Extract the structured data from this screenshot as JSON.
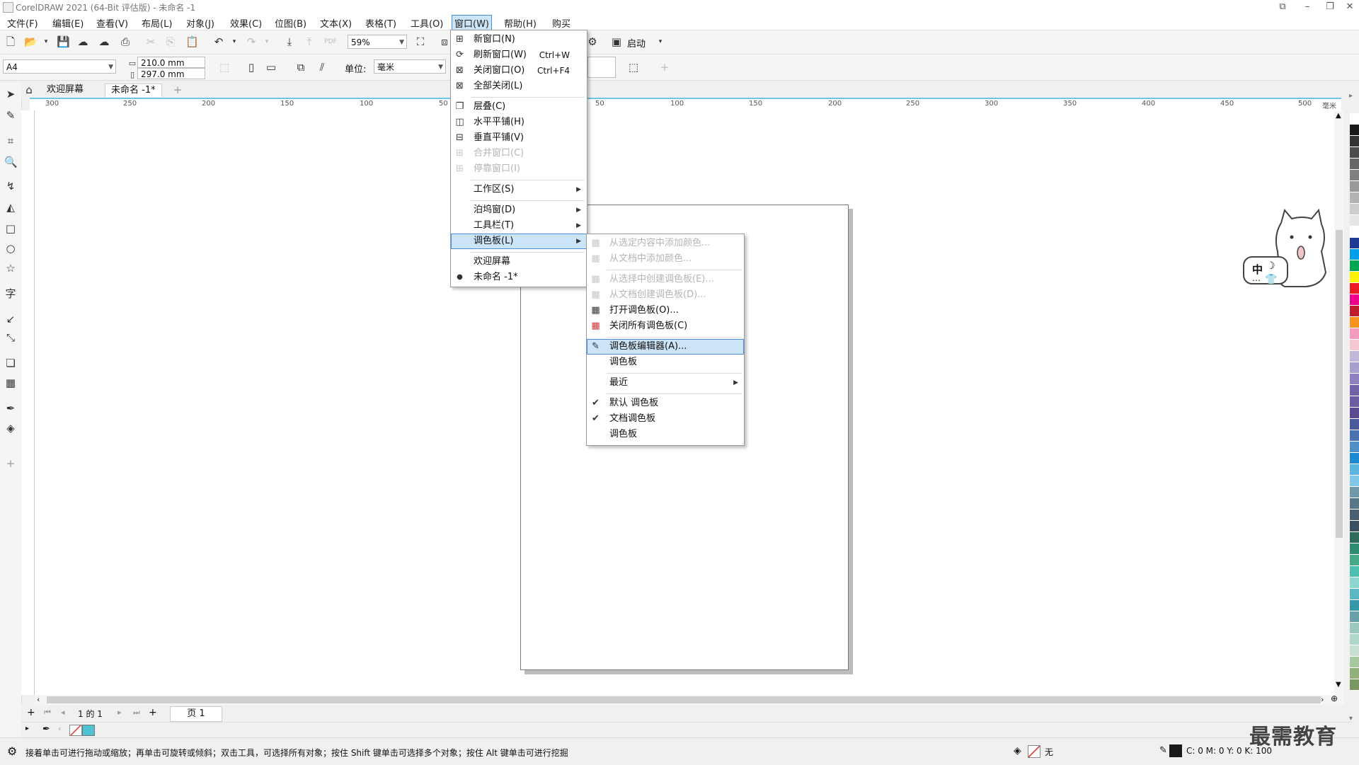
{
  "window": {
    "title": "CorelDRAW 2021 (64-Bit 评估版) - 未命名 -1"
  },
  "menubar": {
    "items": [
      "文件(F)",
      "编辑(E)",
      "查看(V)",
      "布局(L)",
      "对象(J)",
      "效果(C)",
      "位图(B)",
      "文本(X)",
      "表格(T)",
      "工具(O)",
      "窗口(W)",
      "帮助(H)",
      "购买"
    ]
  },
  "toolbar": {
    "zoom": "59%",
    "launch_label": "启动",
    "page_size": "A4",
    "width": "210.0 mm",
    "height": "297.0 mm",
    "units_label": "单位:",
    "units_value": "毫米"
  },
  "doc_tabs": {
    "welcome": "欢迎屏幕",
    "document": "未命名 -1*"
  },
  "ruler": {
    "h_ticks": [
      "300",
      "250",
      "200",
      "150",
      "100",
      "50",
      "50",
      "100",
      "150",
      "200",
      "250",
      "300",
      "350",
      "400",
      "450",
      "500"
    ],
    "h_unit": "毫米"
  },
  "window_menu": {
    "items": [
      {
        "label": "新窗口(N)",
        "shortcut": ""
      },
      {
        "label": "刷新窗口(W)",
        "shortcut": "Ctrl+W"
      },
      {
        "label": "关闭窗口(O)",
        "shortcut": "Ctrl+F4"
      },
      {
        "label": "全部关闭(L)",
        "shortcut": ""
      },
      {
        "label": "层叠(C)"
      },
      {
        "label": "水平平铺(H)"
      },
      {
        "label": "垂直平铺(V)"
      },
      {
        "label": "合并窗口(C)"
      },
      {
        "label": "停靠窗口(I)"
      },
      {
        "label": "工作区(S)"
      },
      {
        "label": "泊坞窗(D)"
      },
      {
        "label": "工具栏(T)"
      },
      {
        "label": "调色板(L)"
      },
      {
        "label": "欢迎屏幕"
      },
      {
        "label": "未命名 -1*"
      }
    ]
  },
  "palette_menu": {
    "items": [
      {
        "label": "从选定内容中添加颜色..."
      },
      {
        "label": "从文档中添加颜色..."
      },
      {
        "label": "从选择中创建调色板(E)..."
      },
      {
        "label": "从文档创建调色板(D)..."
      },
      {
        "label": "打开调色板(O)..."
      },
      {
        "label": "关闭所有调色板(C)"
      },
      {
        "label": "调色板编辑器(A)..."
      },
      {
        "label": "调色板"
      },
      {
        "label": "最近"
      },
      {
        "label": "默认 调色板"
      },
      {
        "label": "文档调色板"
      },
      {
        "label": "调色板"
      }
    ]
  },
  "pagenav": {
    "page_count": "1 的 1",
    "page_tab": "页 1"
  },
  "status": {
    "hint": "接着单击可进行拖动或缩放；再单击可旋转或倾斜；双击工具，可选择所有对象；按住 Shift 键单击可选择多个对象；按住 Alt 键单击可进行挖掘",
    "fill": "无",
    "color_readout": "C: 0 M: 0 Y: 0 K: 100"
  },
  "mascot": {
    "text": "中"
  },
  "watermark": "最需教育",
  "palette_colors": [
    "#ffffff",
    "#1a1a1a",
    "#333333",
    "#4d4d4d",
    "#666666",
    "#808080",
    "#999999",
    "#b3b3b3",
    "#cccccc",
    "#e6e6e6",
    "#ffffff",
    "#1f3a93",
    "#00a0e9",
    "#00a651",
    "#fff200",
    "#ed1c24",
    "#ec008c",
    "#be1e2d",
    "#f7941d",
    "#f49ac1",
    "#f8c8d0",
    "#c2b5d7",
    "#a8a0cc",
    "#8d7fbf",
    "#7462a8",
    "#6e5aa0",
    "#5b4a90",
    "#4a5a9a",
    "#4a72b0",
    "#5090c8",
    "#1b8ad0",
    "#59b5e0",
    "#7fc8e8",
    "#7098a8",
    "#58788a",
    "#4a6070",
    "#3a5060",
    "#2f6a5f",
    "#2d8c72",
    "#48a88a",
    "#4dbfb0",
    "#8cd6d0",
    "#5ab7c3",
    "#3598a8",
    "#6aa0a8",
    "#9ac8c0",
    "#b0d8c8",
    "#c8e0d0",
    "#a8c8a0",
    "#90b078",
    "#789860"
  ]
}
